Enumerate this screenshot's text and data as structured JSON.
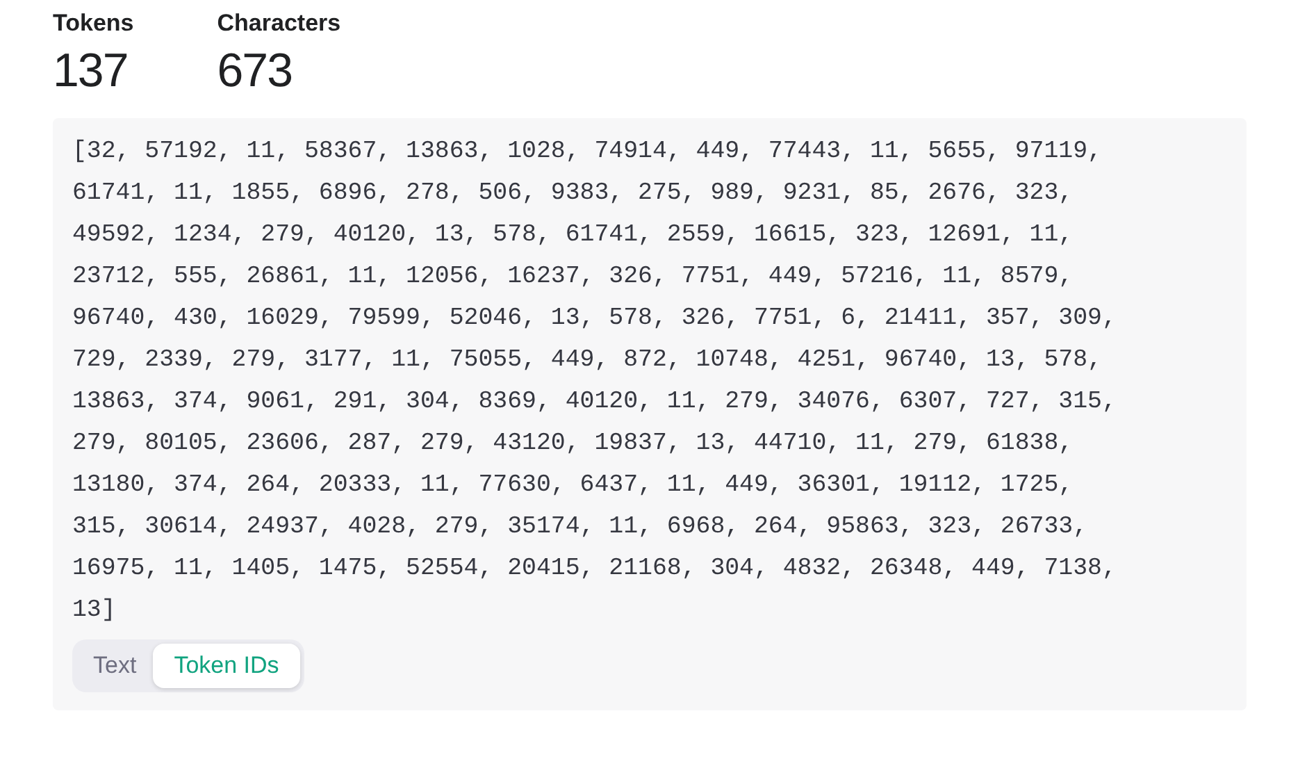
{
  "stats": [
    {
      "label": "Tokens",
      "value": "137"
    },
    {
      "label": "Characters",
      "value": "673"
    }
  ],
  "output": {
    "lines": [
      "[32, 57192, 11, 58367, 13863, 1028, 74914, 449, 77443, 11, 5655, 97119,",
      "61741, 11, 1855, 6896, 278, 506, 9383, 275, 989, 9231, 85, 2676, 323,",
      "49592, 1234, 279, 40120, 13, 578, 61741, 2559, 16615, 323, 12691, 11,",
      "23712, 555, 26861, 11, 12056, 16237, 326, 7751, 449, 57216, 11, 8579,",
      "96740, 430, 16029, 79599, 52046, 13, 578, 326, 7751, 6, 21411, 357, 309,",
      "729, 2339, 279, 3177, 11, 75055, 449, 872, 10748, 4251, 96740, 13, 578,",
      "13863, 374, 9061, 291, 304, 8369, 40120, 11, 279, 34076, 6307, 727, 315,",
      "279, 80105, 23606, 287, 279, 43120, 19837, 13, 44710, 11, 279, 61838,",
      "13180, 374, 264, 20333, 11, 77630, 6437, 11, 449, 36301, 19112, 1725,",
      "315, 30614, 24937, 4028, 279, 35174, 11, 6968, 264, 95863, 323, 26733,",
      "16975, 11, 1405, 1475, 52554, 20415, 21168, 304, 4832, 26348, 449, 7138,",
      "13]"
    ]
  },
  "view_toggle": [
    {
      "label": "Text",
      "selected": false
    },
    {
      "label": "Token IDs",
      "selected": true
    }
  ]
}
